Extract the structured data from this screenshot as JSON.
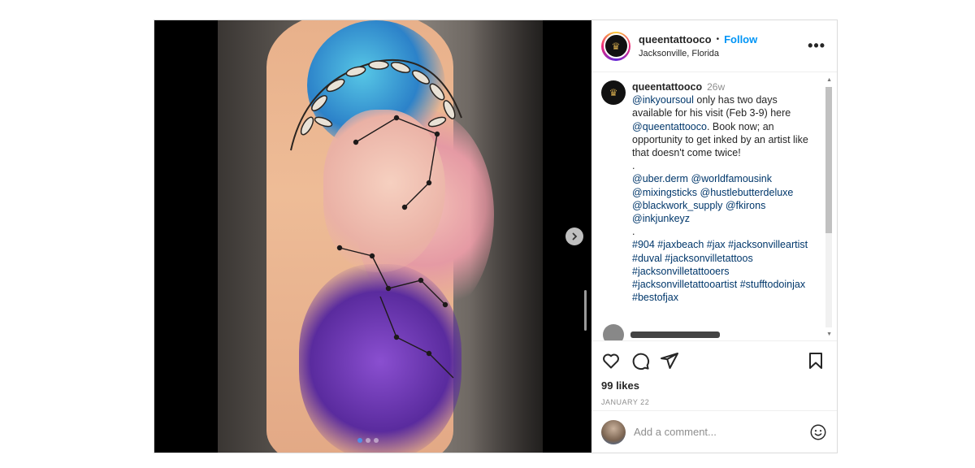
{
  "header": {
    "username": "queentattooco",
    "separator": "•",
    "follow_label": "Follow",
    "location": "Jacksonville, Florida",
    "more_label": "•••"
  },
  "caption": {
    "username": "queentattooco",
    "time": "26w",
    "mention_artist": "@inkyoursoul",
    "text_1": " only has two days available for his visit (Feb 3-9) here ",
    "mention_shop": "@queentattooco",
    "text_2": ". Book now; an opportunity to get inked by an artist like that doesn't come twice!",
    "dot_1": ".",
    "mentions": "@uber.derm @worldfamousink @mixingsticks @hustlebutterdeluxe @blackwork_supply @fkirons @inkjunkeyz",
    "dot_2": ".",
    "hashtags": "#904 #jaxbeach #jax #jacksonvilleartist #duval #jacksonvilletattoos #jacksonvilletattooers #jacksonvilletattooartist #stufftodoinjax #bestofjax"
  },
  "actions": {
    "like_icon": "heart-icon",
    "comment_icon": "comment-icon",
    "share_icon": "paper-plane-icon",
    "save_icon": "bookmark-icon"
  },
  "likes": "99 likes",
  "date": "JANUARY 22",
  "comment_box": {
    "placeholder": "Add a comment..."
  },
  "media": {
    "image_count": 3,
    "active_index": 0,
    "next_icon": "chevron-right-icon"
  },
  "colors": {
    "follow": "#0095f6",
    "link": "#00376b",
    "muted": "#8e8e8e",
    "border": "#dbdbdb"
  }
}
